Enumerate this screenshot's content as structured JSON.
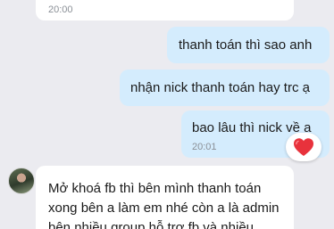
{
  "messages": [
    {
      "id": "top",
      "direction": "incoming",
      "text": "",
      "time": "20:00"
    },
    {
      "id": "1",
      "direction": "outgoing",
      "text": "thanh toán thì sao anh"
    },
    {
      "id": "2",
      "direction": "outgoing",
      "text": "nhận nick thanh toán hay trc ạ"
    },
    {
      "id": "3",
      "direction": "outgoing",
      "text": "bao lâu thì nick về a",
      "time": "20:01",
      "reaction": "heart"
    },
    {
      "id": "4",
      "direction": "incoming",
      "lines": [
        "Mở khoá fb thì bên mình thanh toán",
        "xong bên a làm em nhé còn a là admin",
        "bên nhiều group hỗ trợ fb và nhiều"
      ]
    }
  ],
  "colors": {
    "background": "#ebebf0",
    "outgoing": "#d4ecfd",
    "incoming": "#ffffff",
    "heart": "#e8323c"
  }
}
